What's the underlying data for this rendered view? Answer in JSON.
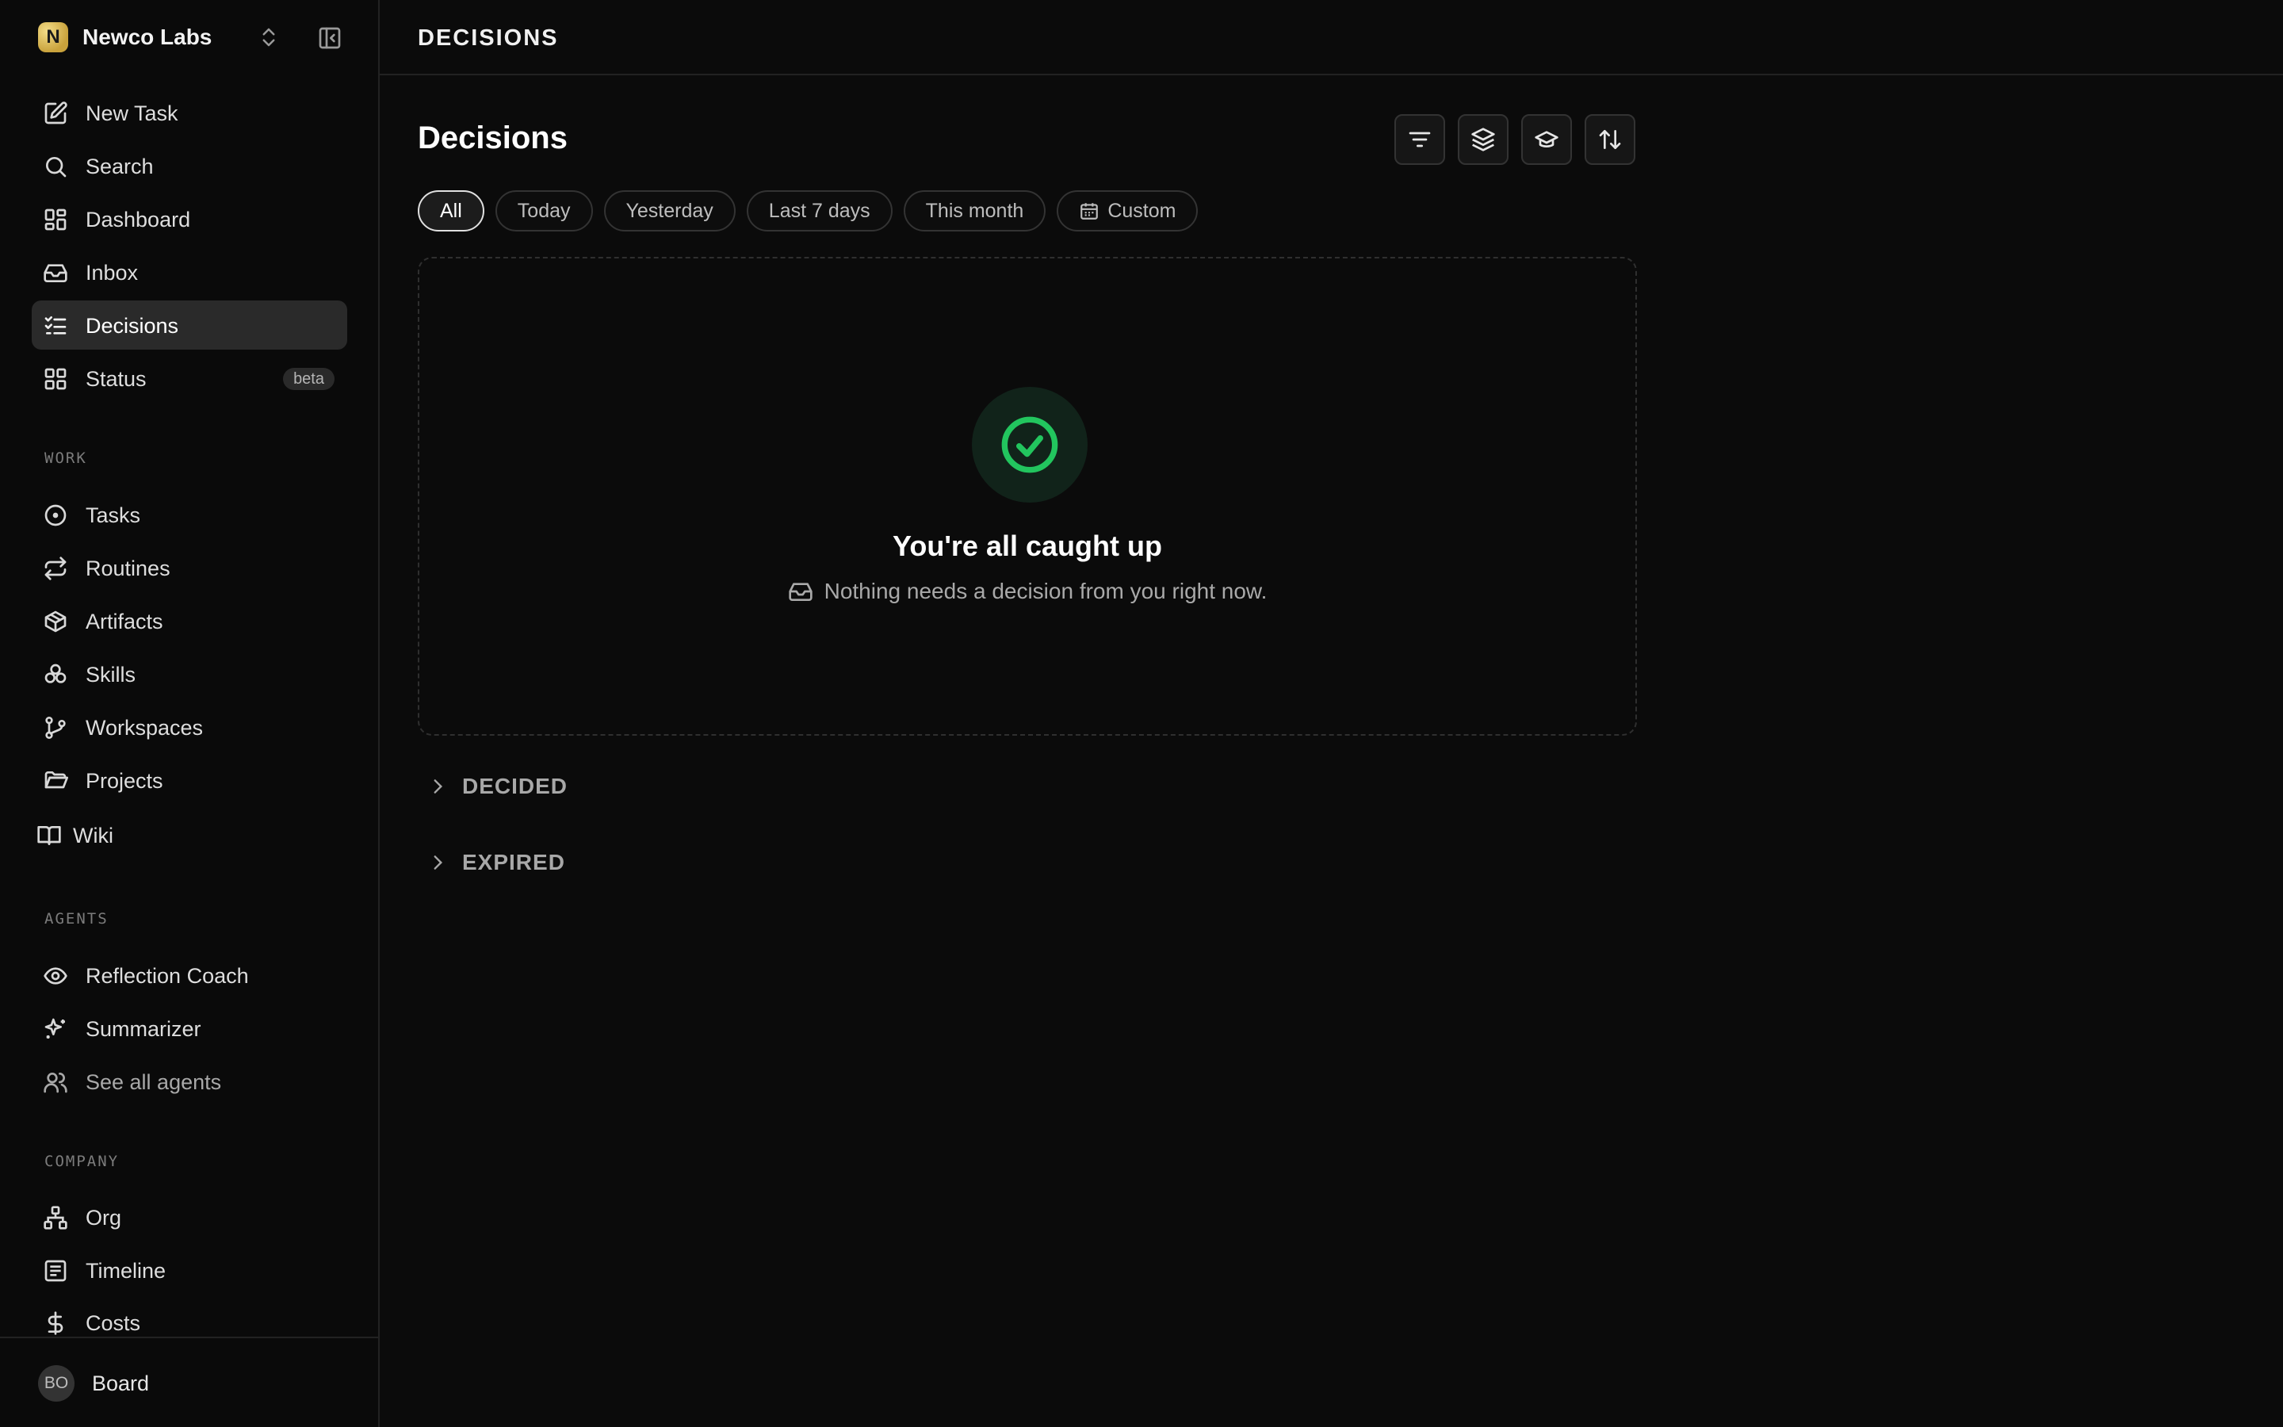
{
  "org": {
    "initial": "N",
    "name": "Newco Labs"
  },
  "nav": {
    "main": [
      {
        "label": "New Task",
        "icon": "edit-icon"
      },
      {
        "label": "Search",
        "icon": "search-icon"
      },
      {
        "label": "Dashboard",
        "icon": "dashboard-icon"
      },
      {
        "label": "Inbox",
        "icon": "inbox-icon"
      },
      {
        "label": "Decisions",
        "icon": "checklist-icon",
        "active": true
      },
      {
        "label": "Status",
        "icon": "grid-icon",
        "badge": "beta"
      }
    ],
    "work_label": "WORK",
    "work": [
      {
        "label": "Tasks",
        "icon": "circle-dot-icon"
      },
      {
        "label": "Routines",
        "icon": "repeat-icon"
      },
      {
        "label": "Artifacts",
        "icon": "box-icon"
      },
      {
        "label": "Skills",
        "icon": "skills-icon"
      },
      {
        "label": "Workspaces",
        "icon": "git-branch-icon"
      },
      {
        "label": "Projects",
        "icon": "folder-icon"
      },
      {
        "label": "Wiki",
        "icon": "book-icon"
      }
    ],
    "agents_label": "AGENTS",
    "agents": [
      {
        "label": "Reflection Coach",
        "icon": "eye-icon"
      },
      {
        "label": "Summarizer",
        "icon": "sparkles-icon"
      },
      {
        "label": "See all agents",
        "icon": "users-icon"
      }
    ],
    "company_label": "COMPANY",
    "company": [
      {
        "label": "Org",
        "icon": "org-chart-icon"
      },
      {
        "label": "Timeline",
        "icon": "timeline-icon"
      },
      {
        "label": "Costs",
        "icon": "dollar-icon"
      }
    ]
  },
  "footer": {
    "avatar_initials": "BO",
    "name": "Board"
  },
  "header": {
    "title": "DECISIONS"
  },
  "page": {
    "title": "Decisions",
    "filters": [
      "All",
      "Today",
      "Yesterday",
      "Last 7 days",
      "This month",
      "Custom"
    ],
    "active_filter": "All",
    "toolbar": [
      "filter-icon",
      "layers-icon",
      "graduation-cap-icon",
      "sort-icon"
    ]
  },
  "empty_state": {
    "title": "You're all caught up",
    "subtitle": "Nothing needs a decision from you right now."
  },
  "sections": {
    "decided": "DECIDED",
    "expired": "EXPIRED"
  },
  "colors": {
    "accent_green": "#22c55e",
    "active_nav": "#2a2a2a"
  }
}
